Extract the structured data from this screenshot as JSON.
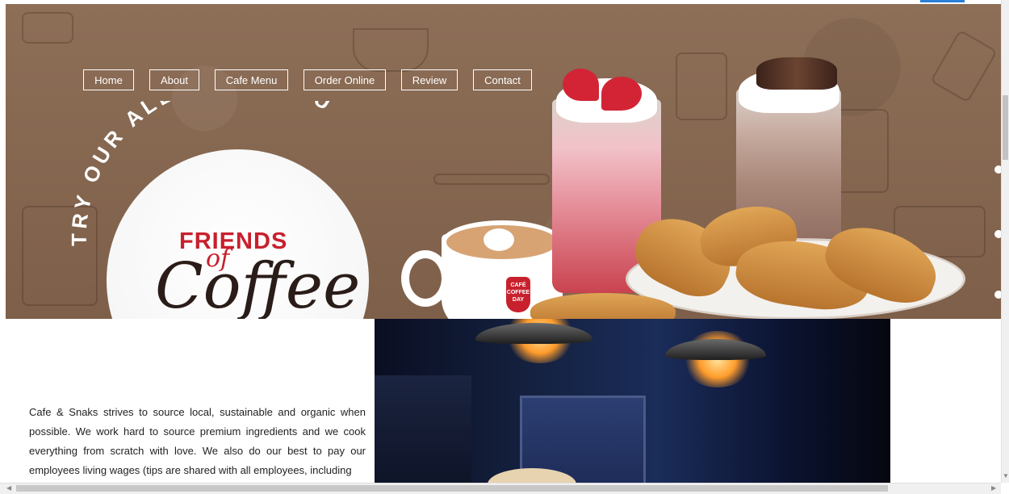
{
  "nav": {
    "items": [
      "Home",
      "About",
      "Cafe Menu",
      "Order Online",
      "Review",
      "Contact"
    ]
  },
  "hero": {
    "tagline": "TRY OUR ALL-NEW MENU",
    "brand_line1": "FRIENDS",
    "brand_line2": "of",
    "brand_line3": "Coffee",
    "cup_logo": "CAFÉ COFFEE DAY"
  },
  "content": {
    "paragraph": "Cafe & Snaks strives to source local, sustainable and organic when possible. We work hard to source premium ingredients and we cook everything from scratch with love. We also do our best to pay our employees living wages (tips are shared with all employees, including"
  },
  "colors": {
    "hero_brown": "#8a6a53",
    "brand_red": "#c8202d",
    "nav_border": "#ffffff"
  }
}
